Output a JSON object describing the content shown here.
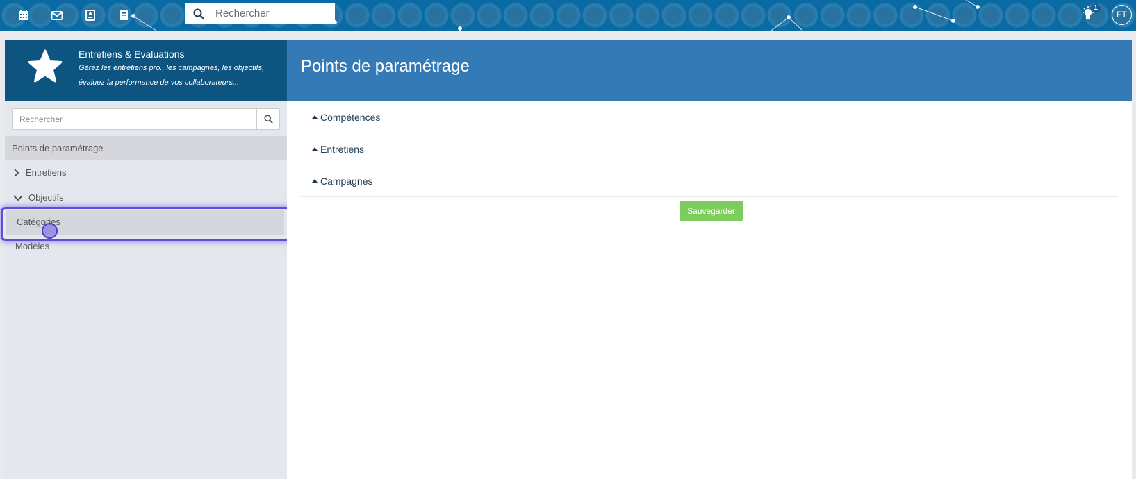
{
  "topbar": {
    "icons": [
      "calendar-icon",
      "mail-icon",
      "contacts-icon",
      "book-icon"
    ],
    "search_placeholder": "Rechercher",
    "notification_count": "1",
    "avatar_initials": "FT"
  },
  "app": {
    "title": "Entretiens & Evaluations",
    "description": "Gérez les entretiens pro., les campagnes, les objectifs, évaluez la performance de vos collaborateurs..."
  },
  "page": {
    "title": "Points de paramétrage"
  },
  "sidebar": {
    "search_placeholder": "Rechercher",
    "section_title": "Points de paramétrage",
    "items": [
      {
        "label": "Entretiens",
        "expanded": false
      },
      {
        "label": "Objectifs",
        "expanded": true,
        "children": [
          {
            "label": "Catégories",
            "selected": true
          },
          {
            "label": "Modèles"
          }
        ]
      }
    ]
  },
  "main": {
    "sections": [
      {
        "label": "Compétences"
      },
      {
        "label": "Entretiens"
      },
      {
        "label": "Campagnes"
      }
    ],
    "save_label": "Sauvegarder"
  },
  "colors": {
    "topbar": "#0a6aa3",
    "app_header": "#0d5580",
    "page_header": "#337ab7",
    "save_button": "#7ccd5b",
    "focus_ring": "#5a4fd8"
  }
}
